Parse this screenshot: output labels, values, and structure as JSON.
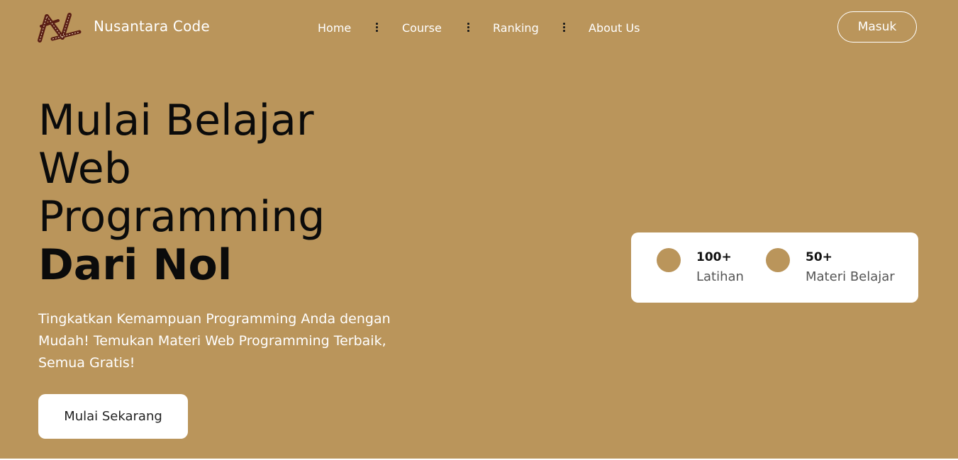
{
  "brand": {
    "name": "Nusantara Code",
    "logo_icon": "nusantara-logo-icon"
  },
  "nav": {
    "items": [
      {
        "label": "Home"
      },
      {
        "label": "Course"
      },
      {
        "label": "Ranking"
      },
      {
        "label": "About Us"
      }
    ],
    "separator_icon": "vertical-dots-icon"
  },
  "header": {
    "login_label": "Masuk"
  },
  "hero": {
    "title_line1": "Mulai Belajar",
    "title_line2": "Web",
    "title_line3": "Programming",
    "title_bold": "Dari Nol",
    "description": "Tingkatkan Kemampuan Programming Anda dengan Mudah! Temukan Materi Web Programming Terbaik, Semua Gratis!",
    "cta_label": "Mulai Sekarang"
  },
  "stats": [
    {
      "value": "100+",
      "label": "Latihan"
    },
    {
      "value": "50+",
      "label": "Materi Belajar"
    }
  ],
  "colors": {
    "background": "#ba955b",
    "text_dark": "#0b0b0b",
    "white": "#ffffff"
  }
}
